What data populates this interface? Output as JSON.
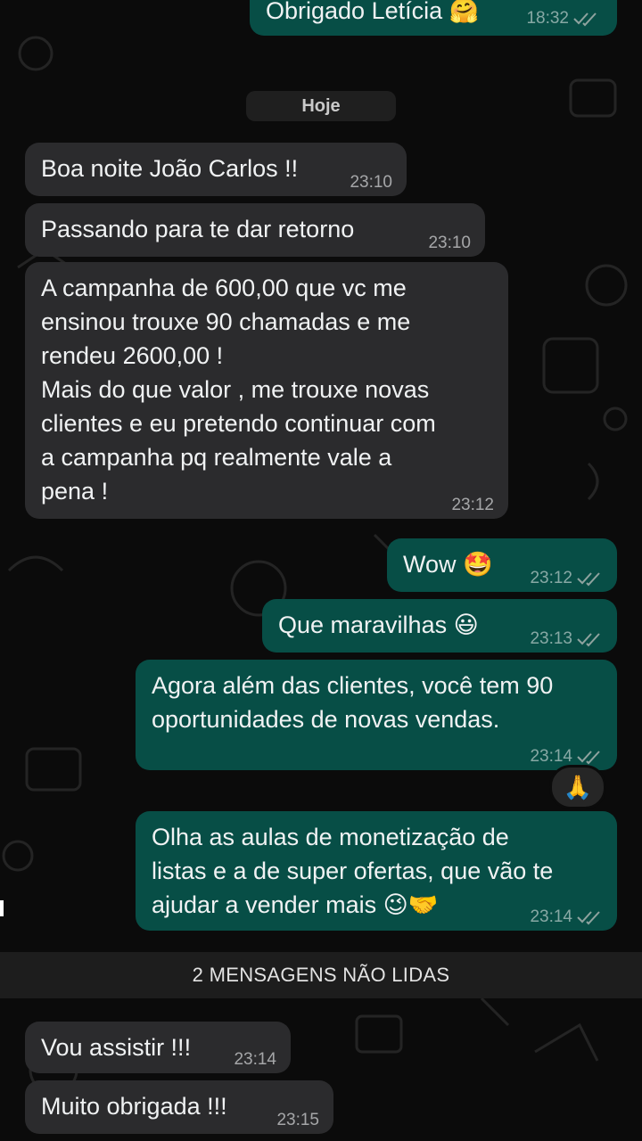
{
  "top_partial": {
    "text": "Obrigado Letícia 🤗",
    "time": "18:32"
  },
  "date_chip": "Hoje",
  "messages": [
    {
      "dir": "in",
      "text": "Boa noite João Carlos !!",
      "time": "23:10"
    },
    {
      "dir": "in",
      "text": "Passando para te dar retorno",
      "time": "23:10"
    },
    {
      "dir": "in",
      "text": "A campanha de 600,00 que vc me\nensinou trouxe 90 chamadas e me\nrendeu 2600,00 !\nMais do que valor , me trouxe novas\nclientes e eu pretendo continuar com\na campanha pq realmente vale a\npena !",
      "time": "23:12"
    },
    {
      "dir": "out",
      "text": "Wow 🤩",
      "time": "23:12"
    },
    {
      "dir": "out",
      "text": "Que maravilhas 😃",
      "time": "23:13"
    },
    {
      "dir": "out",
      "text": "Agora além das clientes, você tem 90\noportunidades de novas vendas.",
      "time": "23:14"
    },
    {
      "dir": "out",
      "text": "Olha as aulas de monetização de\nlistas e a de super ofertas, que vão te\najudar a vender mais 😉🤝",
      "time": "23:14"
    },
    {
      "dir": "in",
      "text": "Vou assistir !!!",
      "time": "23:14"
    },
    {
      "dir": "in",
      "text": "Muito obrigada !!!",
      "time": "23:15"
    }
  ],
  "reaction": "🙏",
  "unread_banner": "2 MENSAGENS NÃO LIDAS",
  "colors": {
    "incoming": "#2b2b2d",
    "outgoing": "#074e46",
    "background": "#0b0b0b"
  }
}
